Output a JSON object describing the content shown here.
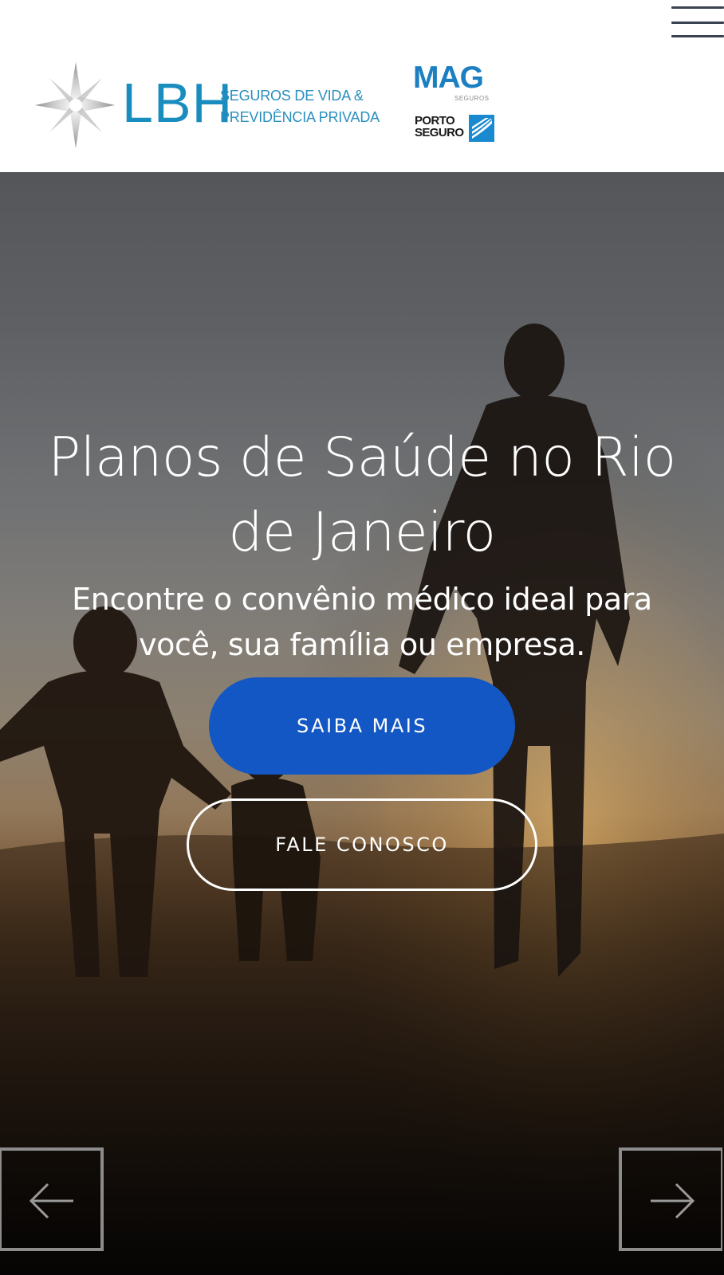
{
  "header": {
    "menu_icon": "hamburger-menu-icon",
    "lbh_logo": {
      "name": "LBH",
      "tagline_line1": "SEGUROS DE VIDA &",
      "tagline_line2": "PREVIDÊNCIA PRIVADA"
    },
    "mag_logo": {
      "name": "MAG",
      "sub": "SEGUROS"
    },
    "porto_logo": {
      "line1": "PORTO",
      "line2": "SEGURO"
    }
  },
  "hero": {
    "title": "Planos de Saúde no Rio de Janeiro",
    "subtitle": "Encontre o convênio médico ideal para você, sua família ou empresa.",
    "primary_button": "SAIBA MAIS",
    "secondary_button": "FALE CONOSCO",
    "prev_icon": "arrow-left-icon",
    "next_icon": "arrow-right-icon"
  },
  "colors": {
    "primary_button": "#1357c4",
    "lbh_blue": "#1a8dbf",
    "mag_blue": "#1c7fc1",
    "menu_icon": "#3a4150"
  }
}
